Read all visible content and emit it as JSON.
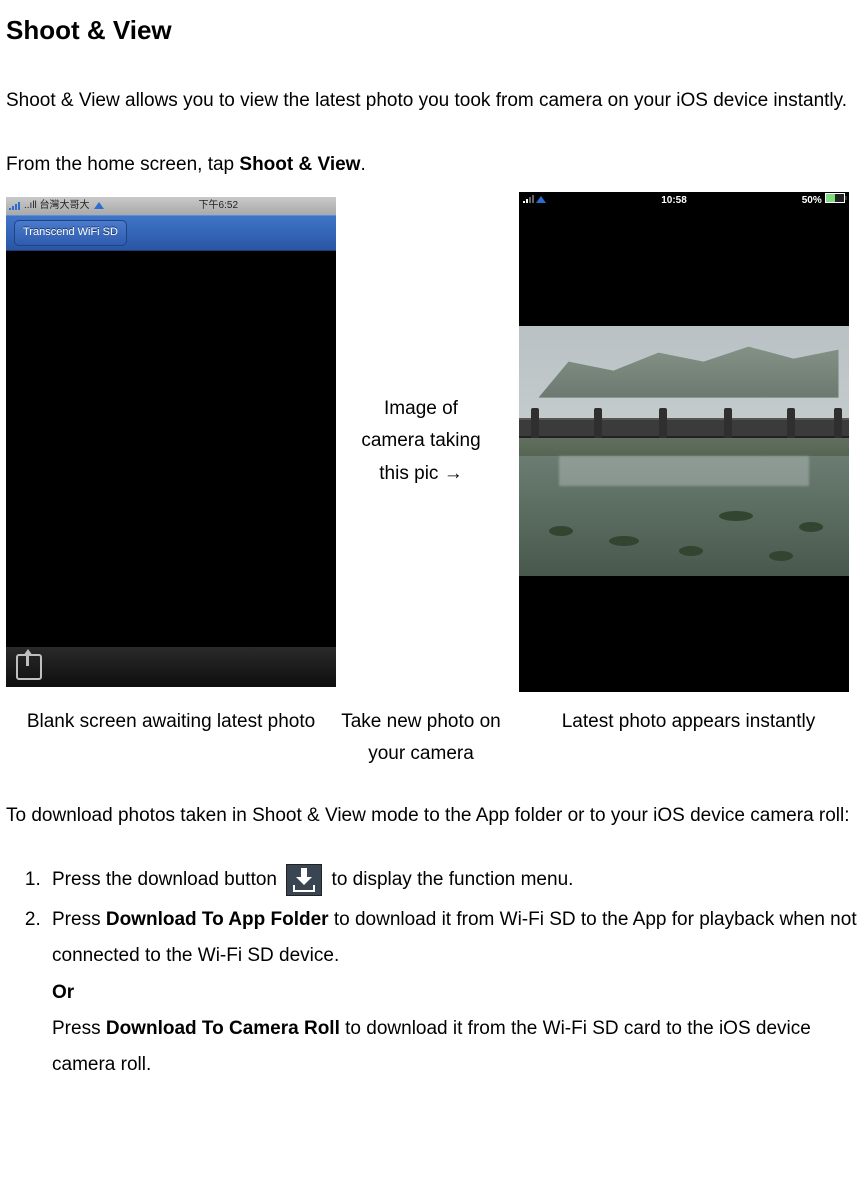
{
  "title": "Shoot & View",
  "intro": "Shoot & View allows you to view the latest photo you took from camera on your iOS device instantly.",
  "instruction_pre": "From the home screen, tap ",
  "instruction_bold": "Shoot & View",
  "screenshot_left": {
    "status_carrier": "..ıll 台灣大哥大",
    "status_time": "下午6:52",
    "back_button": "Transcend WiFi SD"
  },
  "middle_note_line1": "Image of",
  "middle_note_line2": "camera taking",
  "middle_note_line3": "this pic →",
  "screenshot_right": {
    "status_time": "10:58",
    "status_batt": "50%"
  },
  "caption1": "Blank screen awaiting latest photo",
  "caption2": "Take new photo on your camera",
  "caption3": "Latest photo appears instantly",
  "download_intro": "To download photos taken in Shoot & View mode to the App folder or to your iOS device camera roll:",
  "step1_a": "Press the download button ",
  "step1_b": " to display the function menu.",
  "step2_a": "Press ",
  "step2_bold1": "Download To App Folder",
  "step2_b": " to download it from Wi-Fi SD to the App for playback when not connected to the Wi-Fi SD device.",
  "step2_or": "Or",
  "step2_c": "Press ",
  "step2_bold2": "Download To Camera Roll",
  "step2_d": " to download it from the Wi-Fi SD card to the iOS device camera roll."
}
